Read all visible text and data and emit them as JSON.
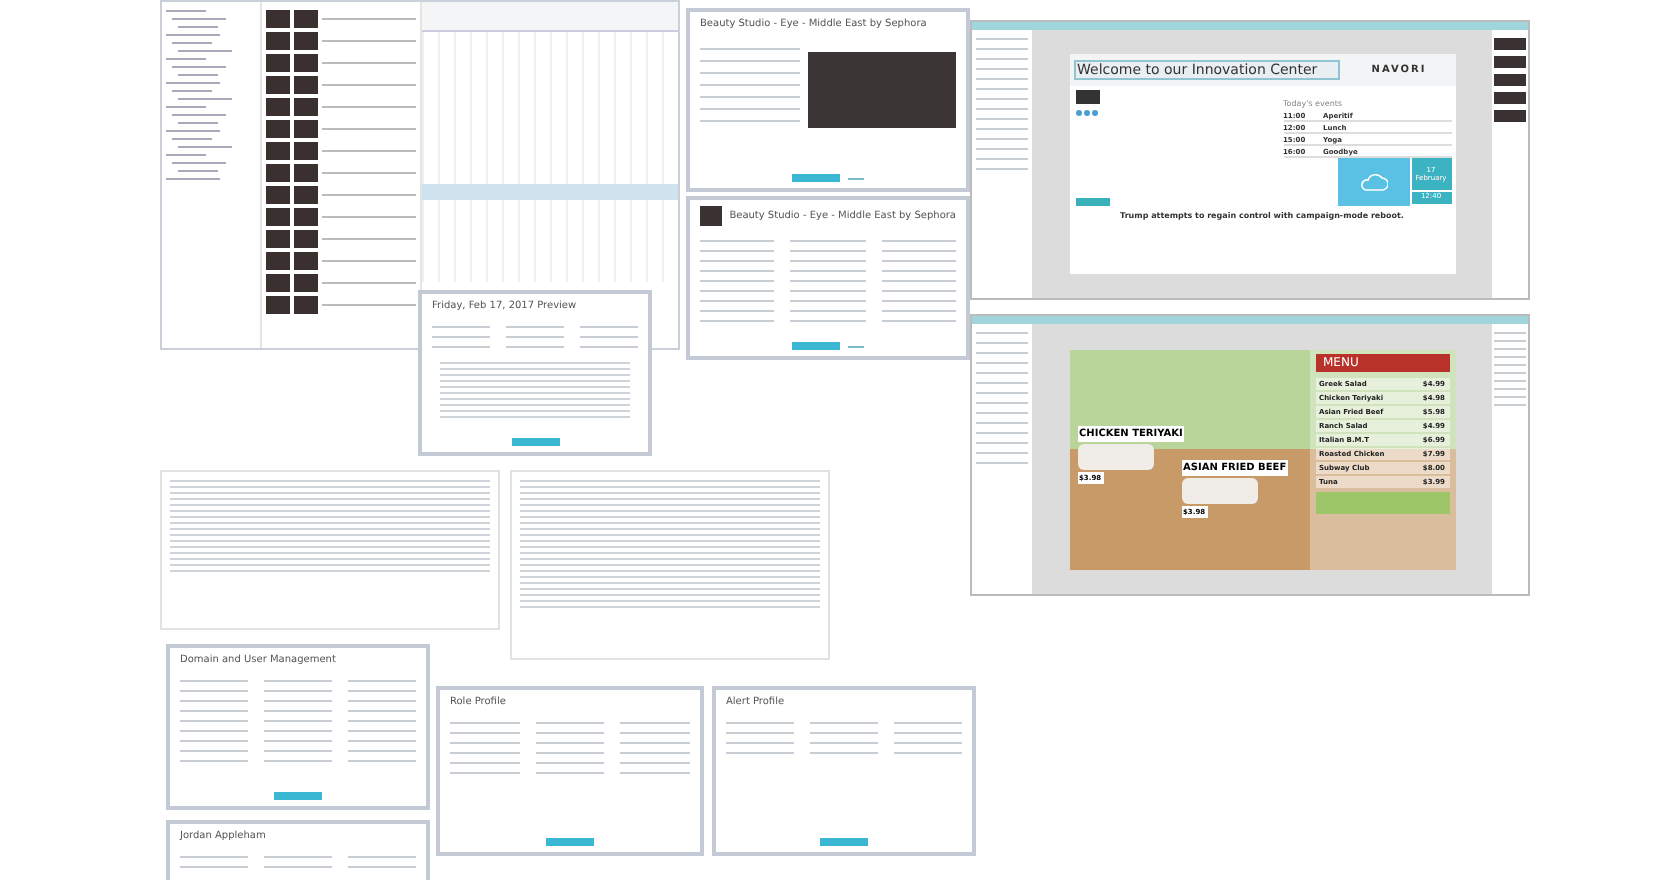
{
  "beauty_editor": {
    "title": "Beauty Studio - Eye - Middle East by Sephora"
  },
  "beauty_schedule": {
    "title": "Beauty Studio - Eye - Middle East by Sephora"
  },
  "innovation_slide": {
    "title": "Welcome to our Innovation Center",
    "logo": "NAVORI",
    "events_heading": "Today's events",
    "events": [
      {
        "time": "11:00",
        "name": "Aperitif"
      },
      {
        "time": "12:00",
        "name": "Lunch"
      },
      {
        "time": "15:00",
        "name": "Yoga"
      },
      {
        "time": "16:00",
        "name": "Goodbye"
      }
    ],
    "date_day": "17",
    "date_month": "February",
    "clock": "12:40",
    "ticker": "Trump attempts to regain control with campaign-mode reboot."
  },
  "menu_slide": {
    "heading": "MENU",
    "items": [
      {
        "name": "Greek Salad",
        "price": "$4.99"
      },
      {
        "name": "Chicken Teriyaki",
        "price": "$4.98"
      },
      {
        "name": "Asian Fried Beef",
        "price": "$5.98"
      },
      {
        "name": "Ranch Salad",
        "price": "$4.99"
      },
      {
        "name": "Italian B.M.T",
        "price": "$6.99"
      },
      {
        "name": "Roasted Chicken",
        "price": "$7.99"
      },
      {
        "name": "Subway Club",
        "price": "$8.00"
      },
      {
        "name": "Tuna",
        "price": "$3.99"
      }
    ],
    "dishes": [
      {
        "name": "CHICKEN TERIYAKI",
        "price": "$3.98"
      },
      {
        "name": "ASIAN FRIED BEEF",
        "price": "$3.98"
      }
    ]
  },
  "preview_dialog": {
    "title": "Friday, Feb 17, 2017 Preview"
  },
  "domain_dialog": {
    "title": "Domain and User Management"
  },
  "application_dialog": {
    "title": "Jordan Appleham"
  },
  "role_dialog": {
    "title": "Role Profile"
  },
  "alert_dialog": {
    "title": "Alert Profile"
  }
}
